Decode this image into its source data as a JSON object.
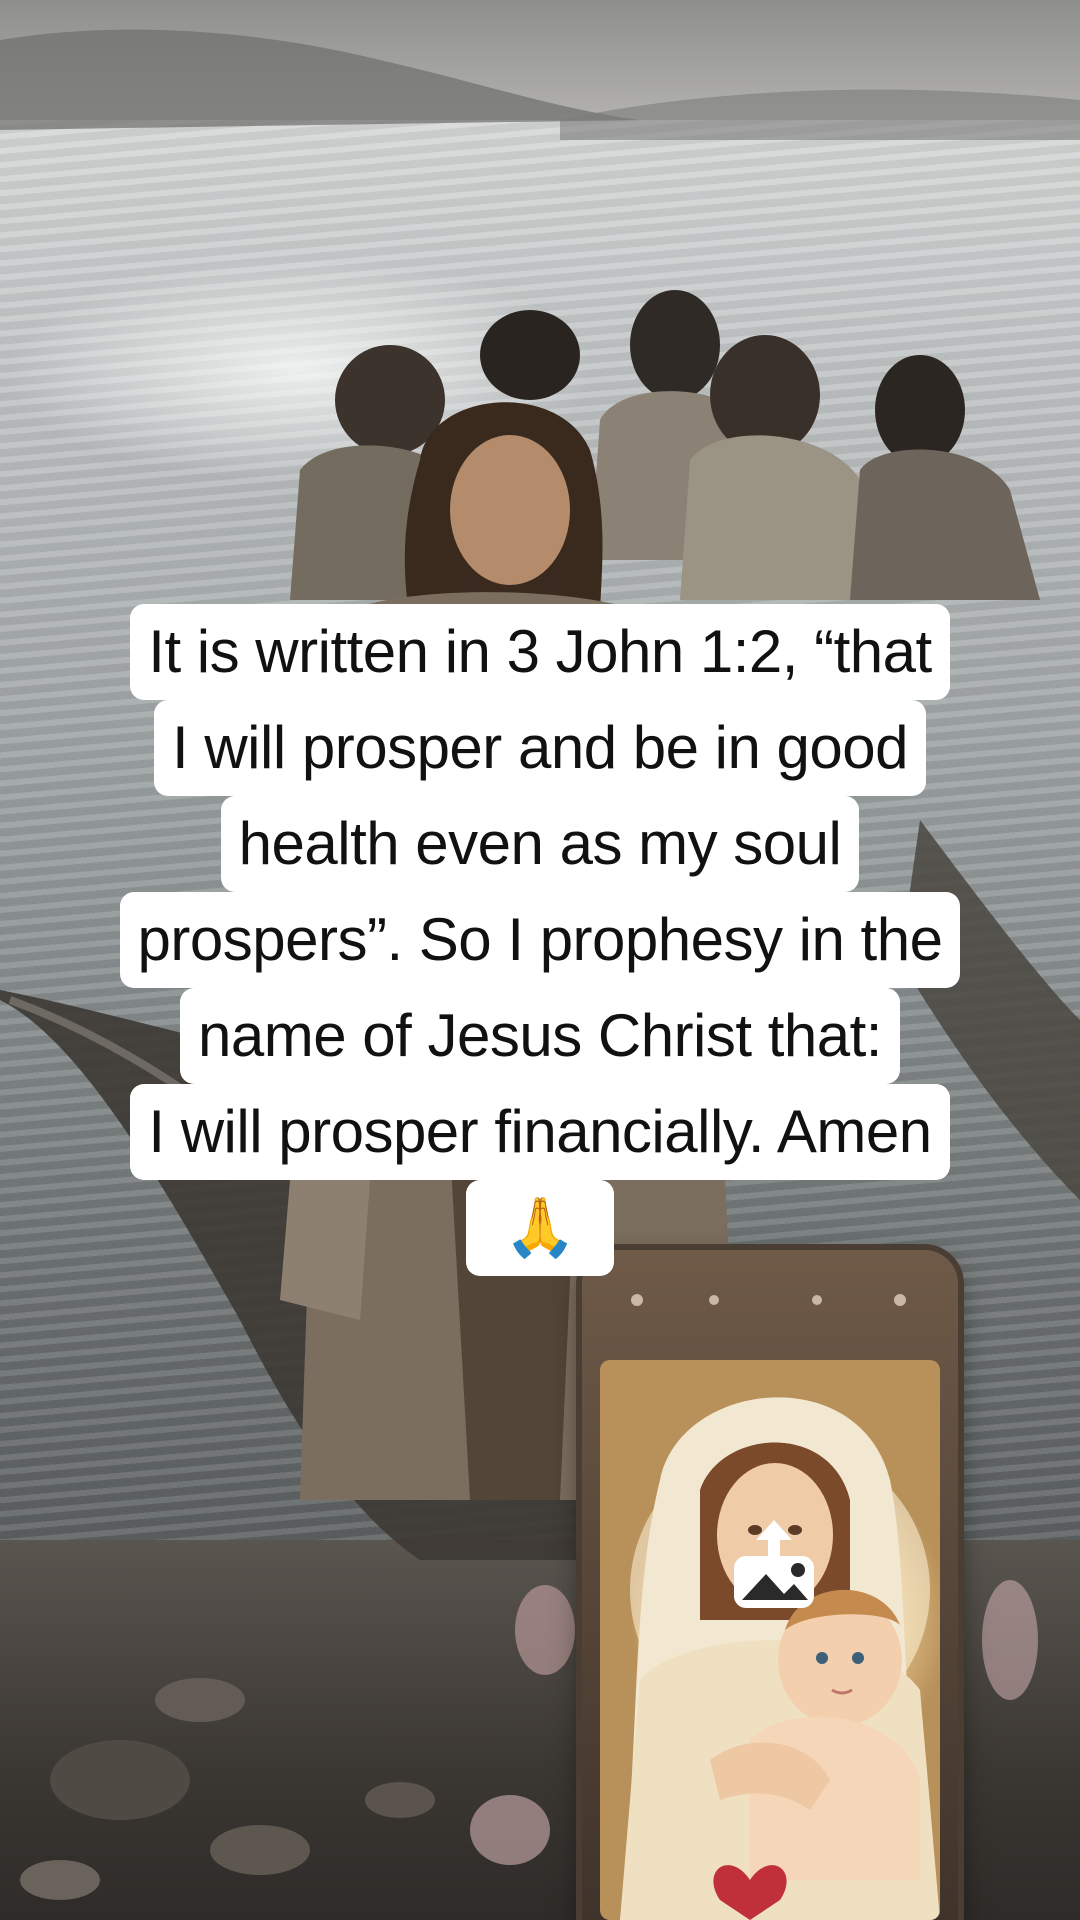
{
  "caption": {
    "lines": [
      "It is written in 3 John 1:2, “that",
      "I will prosper and be in good",
      "health even as my soul",
      "prospers”. So I prophesy in the",
      "name of Jesus Christ that:",
      "I will prosper financially. Amen",
      "🙏"
    ]
  },
  "icons": {
    "share": "share-image-icon",
    "prayer": "folded-hands-emoji"
  },
  "colors": {
    "caption_bg": "#ffffff",
    "caption_text": "#111111"
  }
}
